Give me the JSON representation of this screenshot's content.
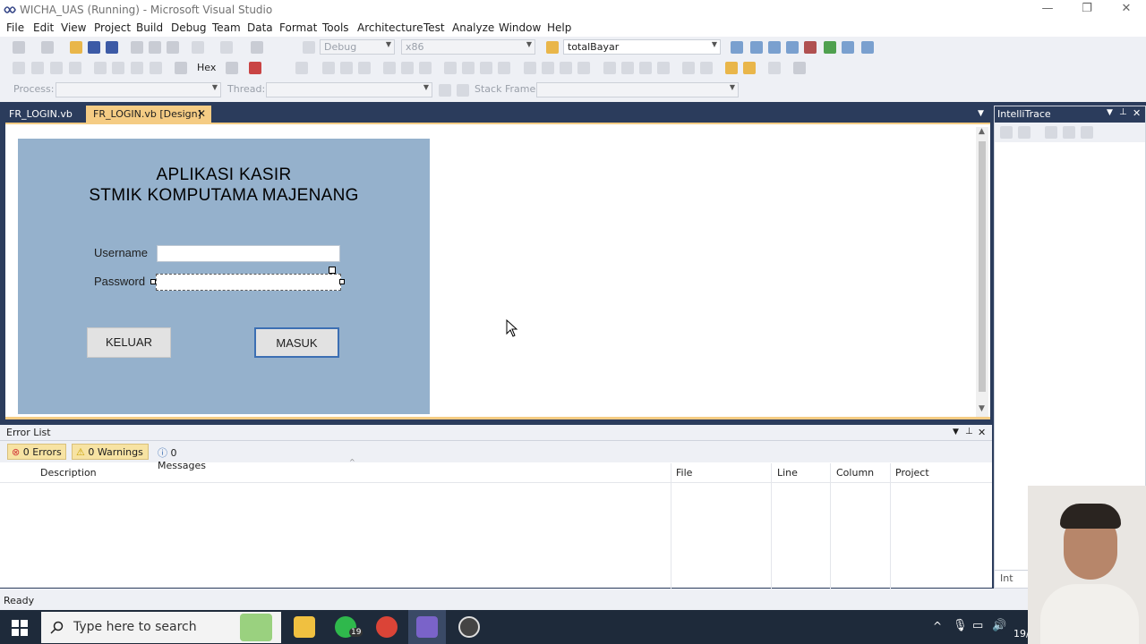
{
  "window": {
    "title": "WICHA_UAS (Running) - Microsoft Visual Studio"
  },
  "menu": [
    "File",
    "Edit",
    "View",
    "Project",
    "Build",
    "Debug",
    "Team",
    "Data",
    "Format",
    "Tools",
    "Architecture",
    "Test",
    "Analyze",
    "Window",
    "Help"
  ],
  "toolbar": {
    "config": "Debug",
    "platform": "x86",
    "find_combo": "totalBayar",
    "hex_label": "Hex",
    "process_label": "Process:",
    "thread_label": "Thread:",
    "stackframe_label": "Stack Frame:"
  },
  "tabs": {
    "code": "FR_LOGIN.vb",
    "design": "FR_LOGIN.vb [Design]"
  },
  "form": {
    "title_line1": "APLIKASI KASIR",
    "title_line2": "STMIK KOMPUTAMA MAJENANG",
    "username_label": "Username",
    "password_label": "Password",
    "exit_button": "KELUAR",
    "login_button": "MASUK"
  },
  "intellitrace": {
    "title": "IntelliTrace",
    "bottom_tab": "Int"
  },
  "error_list": {
    "title": "Error List",
    "errors": "0 Errors",
    "warnings": "0 Warnings",
    "messages": "0 Messages",
    "columns": [
      "Description",
      "File",
      "Line",
      "Column",
      "Project"
    ]
  },
  "status": {
    "text": "Ready"
  },
  "taskbar": {
    "search_placeholder": "Type here to search",
    "whatsapp_badge": "19",
    "clock_fragment": "19/"
  },
  "colors": {
    "form_bg": "#95b1cc",
    "vs_dark": "#2b3c5c",
    "active_tab": "#f5cc84"
  }
}
